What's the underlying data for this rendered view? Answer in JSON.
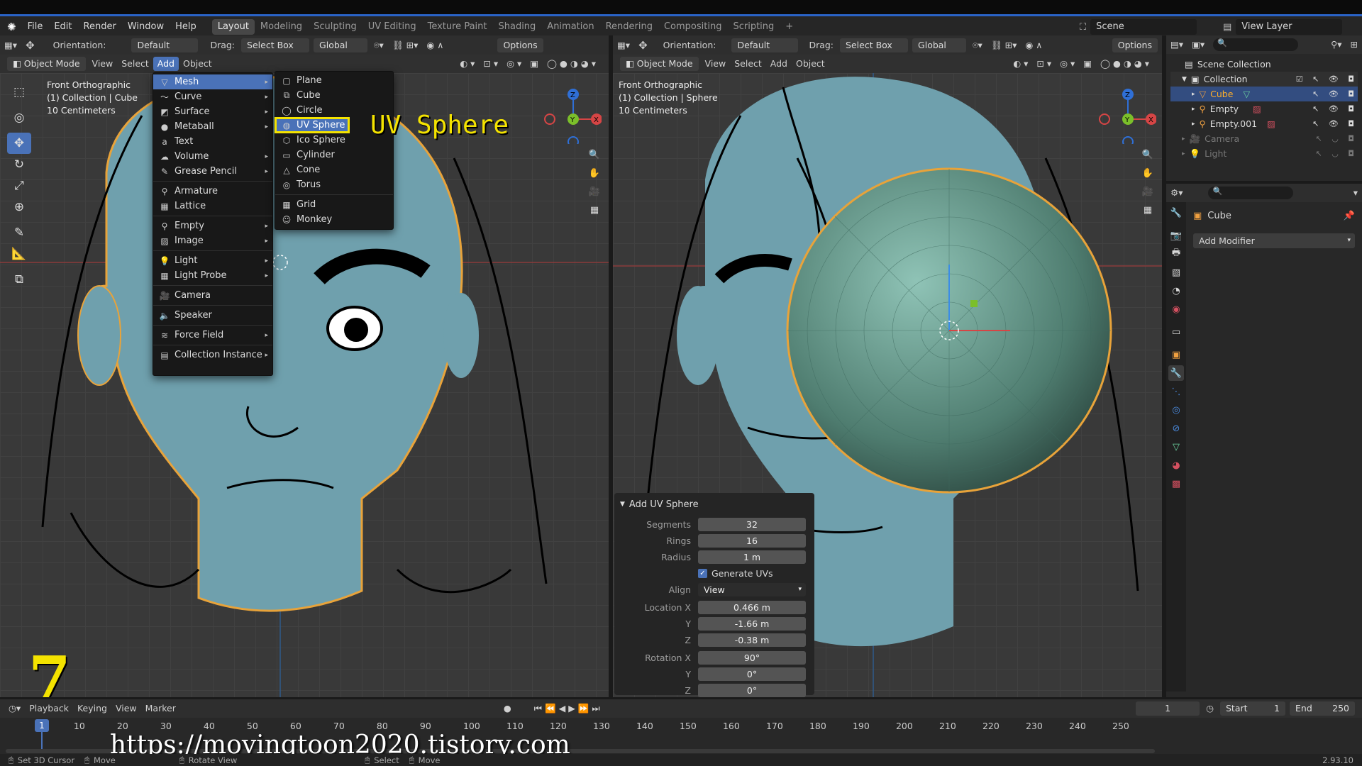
{
  "menubar": {
    "items": [
      "File",
      "Edit",
      "Render",
      "Window",
      "Help"
    ],
    "workspaces": [
      "Layout",
      "Modeling",
      "Sculpting",
      "UV Editing",
      "Texture Paint",
      "Shading",
      "Animation",
      "Rendering",
      "Compositing",
      "Scripting"
    ],
    "add_tab": "+",
    "scene": "Scene",
    "view_layer": "View Layer"
  },
  "left": {
    "orientation_label": "Orientation:",
    "orientation": "Default",
    "drag_label": "Drag:",
    "drag": "Select Box",
    "transform": "Global",
    "options": "Options",
    "mode": "Object Mode",
    "menus": [
      "View",
      "Select",
      "Add",
      "Object"
    ],
    "overlay": [
      "Front Orthographic",
      "(1) Collection | Cube",
      "10 Centimeters"
    ]
  },
  "right": {
    "orientation_label": "Orientation:",
    "orientation": "Default",
    "drag_label": "Drag:",
    "drag": "Select Box",
    "transform": "Global",
    "options": "Options",
    "mode": "Object Mode",
    "menus": [
      "View",
      "Select",
      "Add",
      "Object"
    ],
    "overlay": [
      "Front Orthographic",
      "(1) Collection | Sphere",
      "10 Centimeters"
    ]
  },
  "add_menu": [
    "Mesh",
    "Curve",
    "Surface",
    "Metaball",
    "Text",
    "Volume",
    "Grease Pencil",
    "Armature",
    "Lattice",
    "Empty",
    "Image",
    "Light",
    "Light Probe",
    "Camera",
    "Speaker",
    "Force Field",
    "Collection Instance"
  ],
  "mesh_menu": [
    "Plane",
    "Cube",
    "Circle",
    "UV Sphere",
    "Ico Sphere",
    "Cylinder",
    "Cone",
    "Torus",
    "Grid",
    "Monkey"
  ],
  "annotation": "UV Sphere",
  "op_panel": {
    "title": "Add UV Sphere",
    "rows": [
      {
        "label": "Segments",
        "value": "32"
      },
      {
        "label": "Rings",
        "value": "16"
      },
      {
        "label": "Radius",
        "value": "1 m"
      }
    ],
    "generate_uvs": "Generate UVs",
    "align_label": "Align",
    "align": "View",
    "loc": [
      {
        "label": "Location X",
        "value": "0.466 m"
      },
      {
        "label": "Y",
        "value": "-1.66 m"
      },
      {
        "label": "Z",
        "value": "-0.38 m"
      }
    ],
    "rot": [
      {
        "label": "Rotation X",
        "value": "90°"
      },
      {
        "label": "Y",
        "value": "0°"
      },
      {
        "label": "Z",
        "value": "0°"
      }
    ]
  },
  "outliner": {
    "title": "Scene Collection",
    "items": [
      "Collection",
      "Cube",
      "Empty",
      "Empty.001",
      "Camera",
      "Light"
    ]
  },
  "properties": {
    "object": "Cube",
    "add_modifier": "Add Modifier"
  },
  "timeline": {
    "menus": [
      "Playback",
      "Keying",
      "View",
      "Marker"
    ],
    "current": "1",
    "start_label": "Start",
    "start": "1",
    "end_label": "End",
    "end": "250",
    "ticks": [
      "1",
      "10",
      "20",
      "30",
      "40",
      "50",
      "60",
      "70",
      "80",
      "90",
      "100",
      "110",
      "120",
      "130",
      "140",
      "150",
      "160",
      "170",
      "180",
      "190",
      "200",
      "210",
      "220",
      "230",
      "240",
      "250"
    ]
  },
  "statusbar": {
    "items": [
      "Set 3D Cursor",
      "Move",
      "Rotate View",
      "Select",
      "Move"
    ],
    "version": "2.93.10"
  },
  "step_number": "7",
  "watermark": "https://movingtoon2020.tistory.com"
}
